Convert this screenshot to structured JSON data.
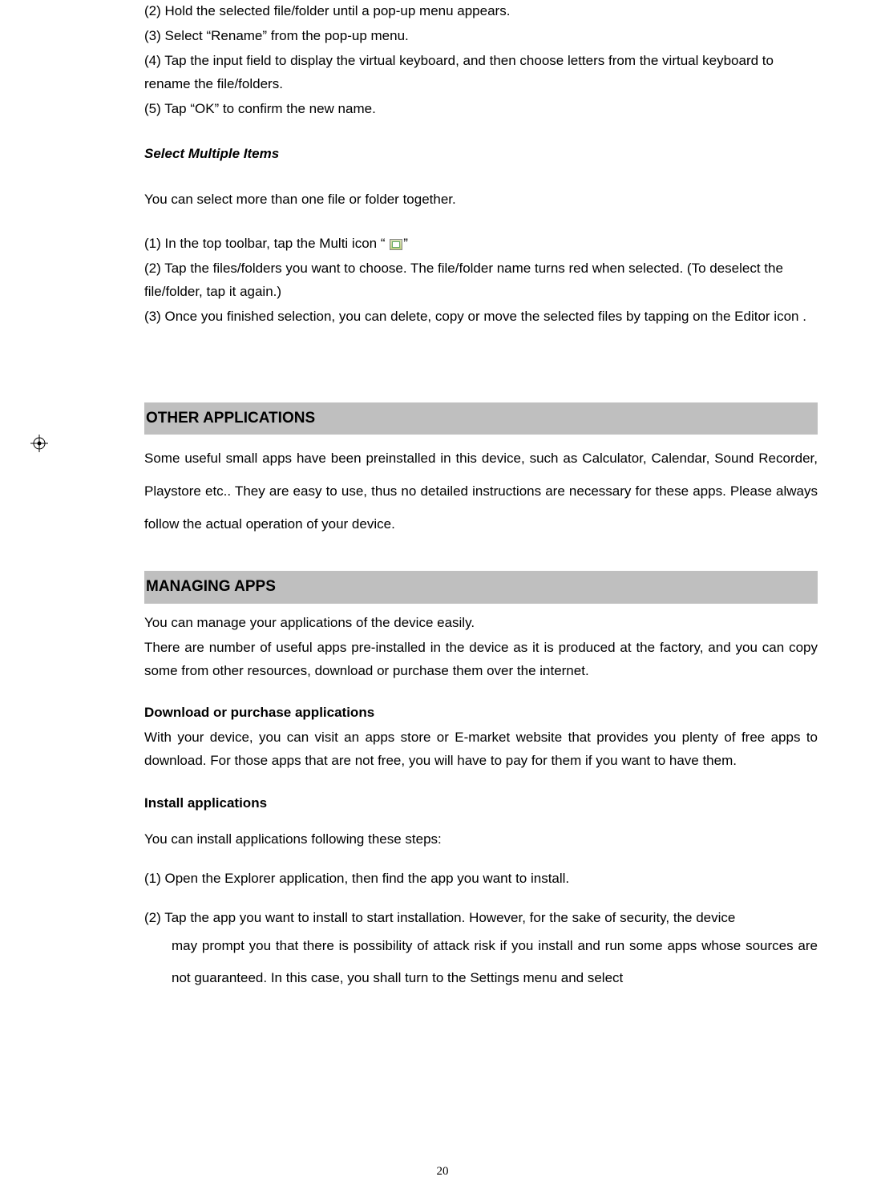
{
  "rename_steps": {
    "s2": "(2)    Hold the selected file/folder until a pop-up menu appears.",
    "s3": "(3)    Select “Rename” from the pop-up menu.",
    "s4": "(4)    Tap the input field to display the virtual keyboard, and then choose letters from the virtual keyboard to rename the file/folders.",
    "s5": "(5)    Tap “OK” to confirm the new name."
  },
  "select_multi": {
    "heading": "Select Multiple Items",
    "intro": "You can select more than one file or folder together.",
    "s1_pre": "(1)    In the top toolbar, tap the Multi icon “ ",
    "s1_post": "”",
    "s2": "(2)    Tap the files/folders you want to choose. The file/folder name turns red when selected. (To deselect the file/folder, tap it again.)",
    "s3": "(3)    Once you finished selection, you can delete, copy or move the selected files by tapping on the Editor icon      ."
  },
  "other_apps": {
    "heading": "OTHER APPLICATIONS",
    "body": "Some useful small apps have been preinstalled in this device, such as Calculator, Calendar, Sound Recorder, Playstore etc.. They are easy to use, thus no detailed instructions are necessary for these apps. Please always follow the actual operation of your device."
  },
  "managing": {
    "heading": "MANAGING APPS",
    "p1": "You can manage your applications of the device easily.",
    "p2": "There are number of useful apps pre-installed in the device as it is produced at the factory, and you can copy some from other resources, download or purchase them over the internet.",
    "download_h": "Download or purchase applications",
    "download_b": "With your device, you can visit an apps store or E-market website that provides you plenty of free apps to download. For those apps that are not free, you will have to pay for them if you want to have them.",
    "install_h": "Install applications",
    "install_intro": "You can install applications following these steps:",
    "install_s1": "(1)    Open the Explorer application, then find the app you want to install.",
    "install_s2_a": "(2)    Tap the app you want to install to start installation. However, for the sake of security, the device",
    "install_s2_b": "may prompt you that there is possibility of attack risk if you install and run some apps whose sources are not guaranteed. In this case, you shall turn to the Settings menu and select"
  },
  "page_number": "20"
}
